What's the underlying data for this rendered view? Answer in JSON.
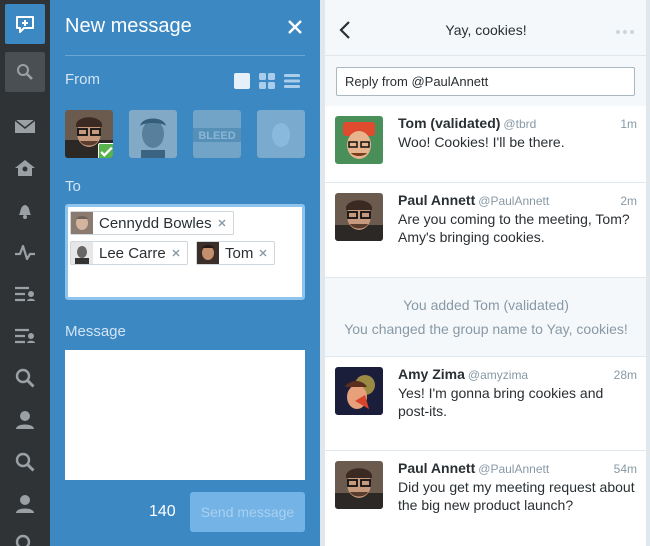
{
  "colors": {
    "brand_blue": "#3b88c3",
    "rail_dark": "#2f3336",
    "verified_green": "#58b34d",
    "muted_text": "#8899a6"
  },
  "rail": {
    "items": [
      {
        "icon": "compose-icon"
      },
      {
        "icon": "search-icon"
      },
      {
        "icon": "messages-icon"
      },
      {
        "icon": "home-icon"
      },
      {
        "icon": "notifications-icon"
      },
      {
        "icon": "activity-icon"
      },
      {
        "icon": "list-icon"
      },
      {
        "icon": "list-icon"
      },
      {
        "icon": "search-icon"
      },
      {
        "icon": "user-icon"
      },
      {
        "icon": "search-icon"
      },
      {
        "icon": "user-icon"
      }
    ]
  },
  "compose": {
    "title": "New message",
    "from_label": "From",
    "to_label": "To",
    "message_label": "Message",
    "from_accounts": [
      {
        "name": "selected-account",
        "selected": true
      },
      {
        "name": "account-2",
        "selected": false
      },
      {
        "name": "account-bleed",
        "selected": false
      },
      {
        "name": "account-egg",
        "selected": false
      }
    ],
    "recipients": [
      {
        "name": "Cennydd Bowles"
      },
      {
        "name": "Lee Carre"
      },
      {
        "name": "Tom"
      }
    ],
    "message_value": "",
    "char_count": "140",
    "send_label": "Send message"
  },
  "conversation": {
    "title": "Yay, cookies!",
    "reply_value": "Reply from @PaulAnnett",
    "messages": [
      {
        "name": "Tom (validated)",
        "handle": "@tbrd",
        "time": "1m",
        "text": "Woo!  Cookies! I'll be there."
      },
      {
        "name": "Paul Annett",
        "handle": "@PaulAnnett",
        "time": "2m",
        "text": "Are you coming to the meeting, Tom? Amy's bringing cookies."
      },
      {
        "name": "Amy Zima",
        "handle": "@amyzima",
        "time": "28m",
        "text": "Yes! I'm gonna bring cookies and post-its."
      },
      {
        "name": "Paul Annett",
        "handle": "@PaulAnnett",
        "time": "54m",
        "text": "Did you get my meeting request about the big new product launch?"
      }
    ],
    "system_notes": [
      "You added Tom (validated)",
      "You changed the group name to Yay, cookies!"
    ]
  }
}
